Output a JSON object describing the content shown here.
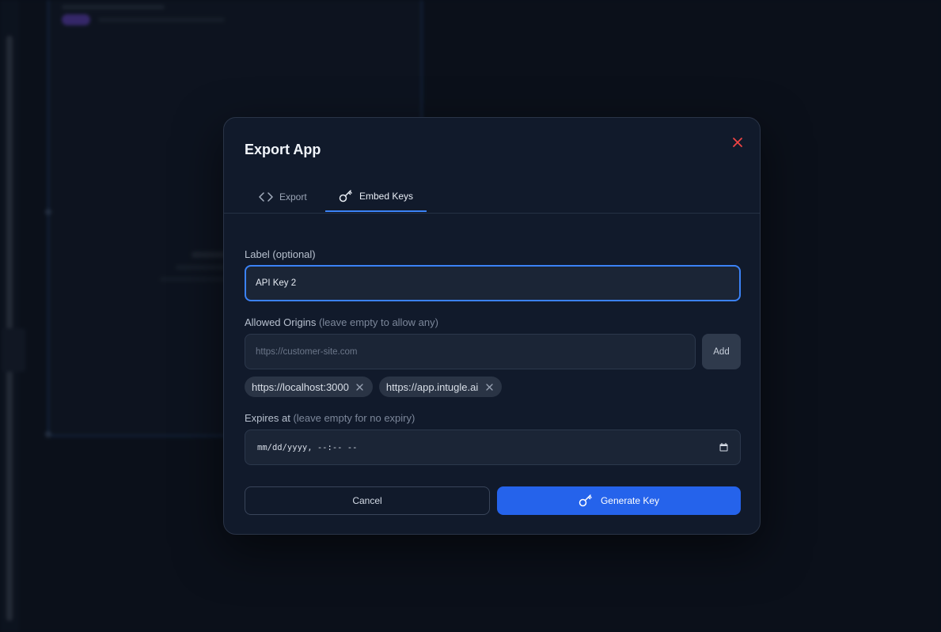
{
  "dialog": {
    "title": "Export App",
    "close_icon": "close-icon"
  },
  "tabs": [
    {
      "label": "Export",
      "icon": "code-icon",
      "active": false
    },
    {
      "label": "Embed Keys",
      "icon": "key-icon",
      "active": true
    }
  ],
  "form": {
    "label_field": {
      "label": "Label (optional)",
      "value": "API Key 2"
    },
    "origins_field": {
      "label": "Allowed Origins",
      "hint": "(leave empty to allow any)",
      "placeholder": "https://customer-site.com",
      "add_label": "Add",
      "chips": [
        "https://localhost:3000",
        "https://app.intugle.ai"
      ]
    },
    "expires_field": {
      "label": "Expires at",
      "hint": "(leave empty for no expiry)",
      "placeholder": "mm/dd/yyyy, --:-- --"
    }
  },
  "actions": {
    "cancel_label": "Cancel",
    "generate_label": "Generate Key"
  },
  "colors": {
    "accent": "#3b82f6",
    "primary_button": "#2563eb",
    "close": "#ef4444"
  }
}
